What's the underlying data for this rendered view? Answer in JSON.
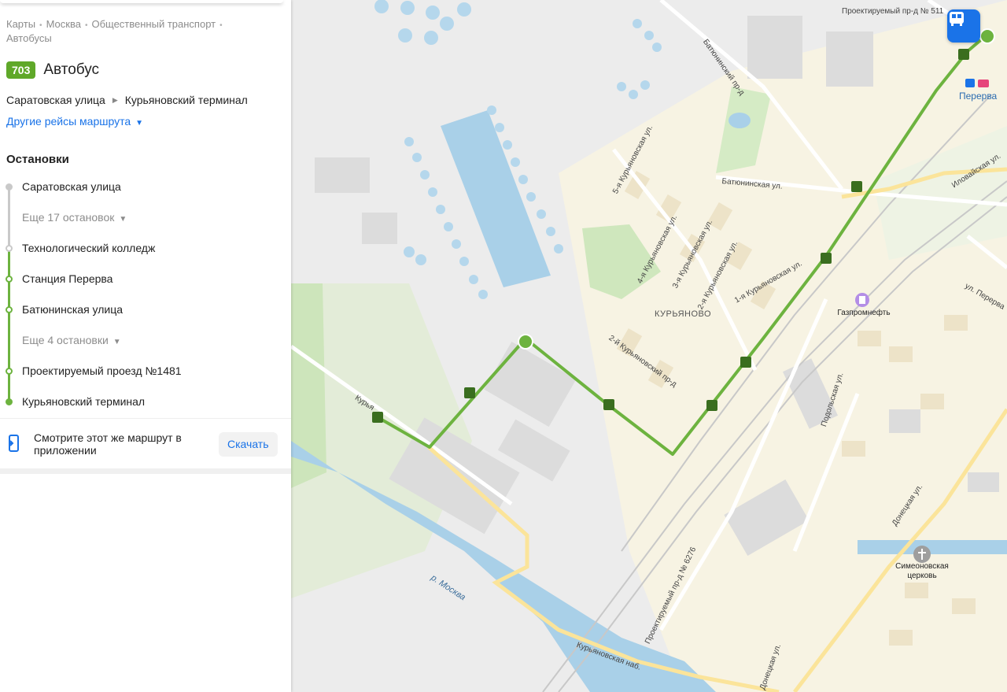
{
  "breadcrumb": [
    "Карты",
    "Москва",
    "Общественный транспорт",
    "Автобусы"
  ],
  "route": {
    "number": "703",
    "title": "Автобус",
    "from": "Саратовская улица",
    "to": "Курьяновский терминал",
    "other_trips": "Другие рейсы маршрута"
  },
  "stops_heading": "Остановки",
  "stops": [
    {
      "label": "Саратовская улица"
    },
    {
      "label": "Еще 17 остановок"
    },
    {
      "label": "Технологический колледж"
    },
    {
      "label": "Станция Перерва"
    },
    {
      "label": "Батюнинская улица"
    },
    {
      "label": "Еще 4 остановки"
    },
    {
      "label": "Проектируемый проезд №1481"
    },
    {
      "label": "Курьяновский терминал"
    }
  ],
  "promo": {
    "text": "Смотрите этот же маршрут в приложении",
    "button": "Скачать"
  },
  "map": {
    "streets": {
      "pr511": "Проектируемый пр-д № 511",
      "batyuninsky_pr": "Батюнинский пр-д",
      "batyuninskaya": "Батюнинская ул.",
      "ilovayskaya": "Иловайская ул.",
      "kur5": "5-я Курьяновская ул.",
      "kur4": "4-я Курьяновская ул.",
      "kur3": "3-я Курьяновская ул.",
      "kur2": "2-я Курьяновская ул.",
      "kur1": "1-я Курьяновская ул.",
      "kur2pr": "2-й Курьяновский пр-д",
      "kur_short": "Курья",
      "pererva_ul": "ул. Перерва",
      "podolskaya": "Подольская ул.",
      "donetskaya_top": "Донецкая ул.",
      "donetskaya_bottom": "Донецкая ул.",
      "pr6276": "Проектируемый пр-д № 6276",
      "kur_nab": "Курьяновская наб."
    },
    "district": "КУРЬЯНОВО",
    "river": "р. Москва",
    "metro": "Перерва",
    "metro_line": "D2",
    "pois": {
      "gazprom": "Газпромнефть",
      "church": "Симеоновская церковь"
    },
    "route_color": "#6db33f"
  }
}
